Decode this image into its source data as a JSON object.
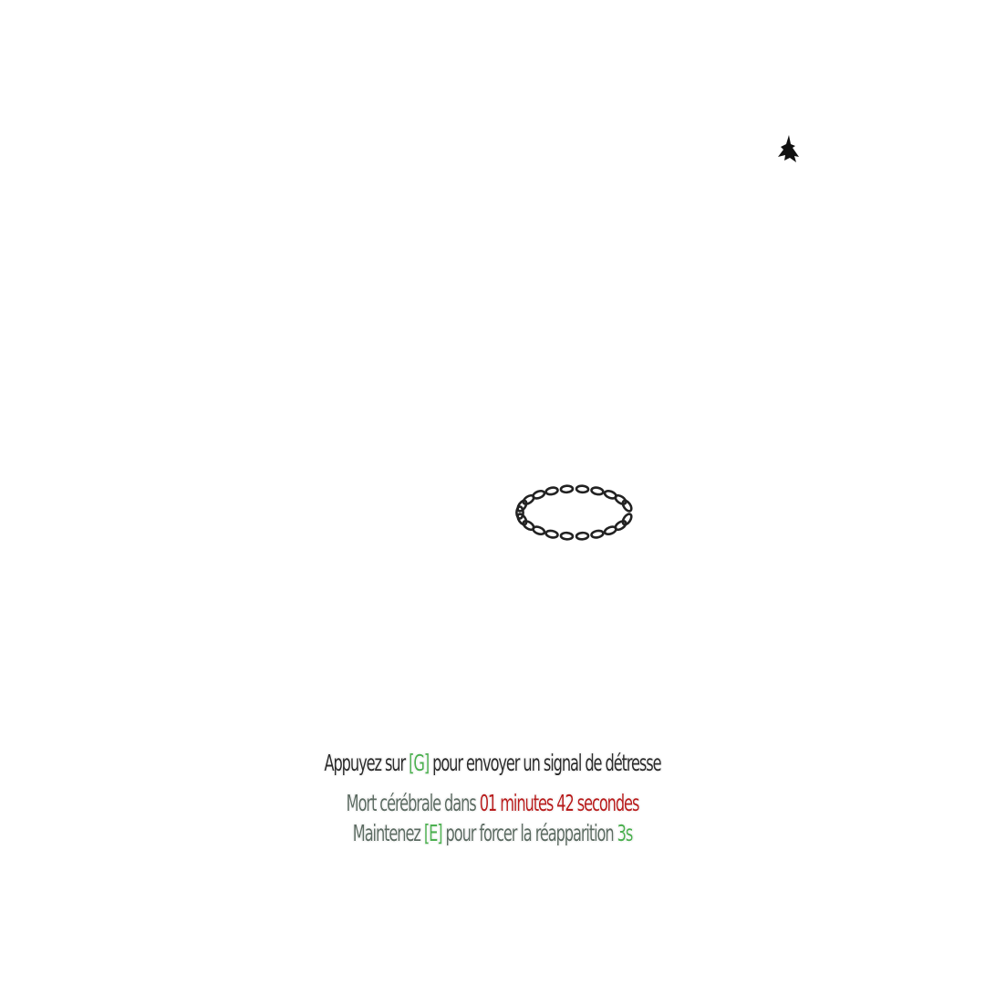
{
  "hud": {
    "distress": {
      "prefix": "Appuyez sur ",
      "key": "[G]",
      "suffix": " pour envoyer un signal de détresse"
    },
    "brain_death": {
      "prefix": "Mort cérébrale dans ",
      "timer": "01 minutes 42 secondes"
    },
    "respawn": {
      "prefix": "Maintenez ",
      "key": "[E]",
      "middle": " pour forcer la réapparition ",
      "time": "3s"
    }
  },
  "icons": {
    "cursor": "cursor-arrow-icon",
    "chain": "chain-ring-icon"
  },
  "colors": {
    "key_highlight": "#4caf50",
    "timer": "#b71c1c",
    "text": "#2a2a2a"
  }
}
